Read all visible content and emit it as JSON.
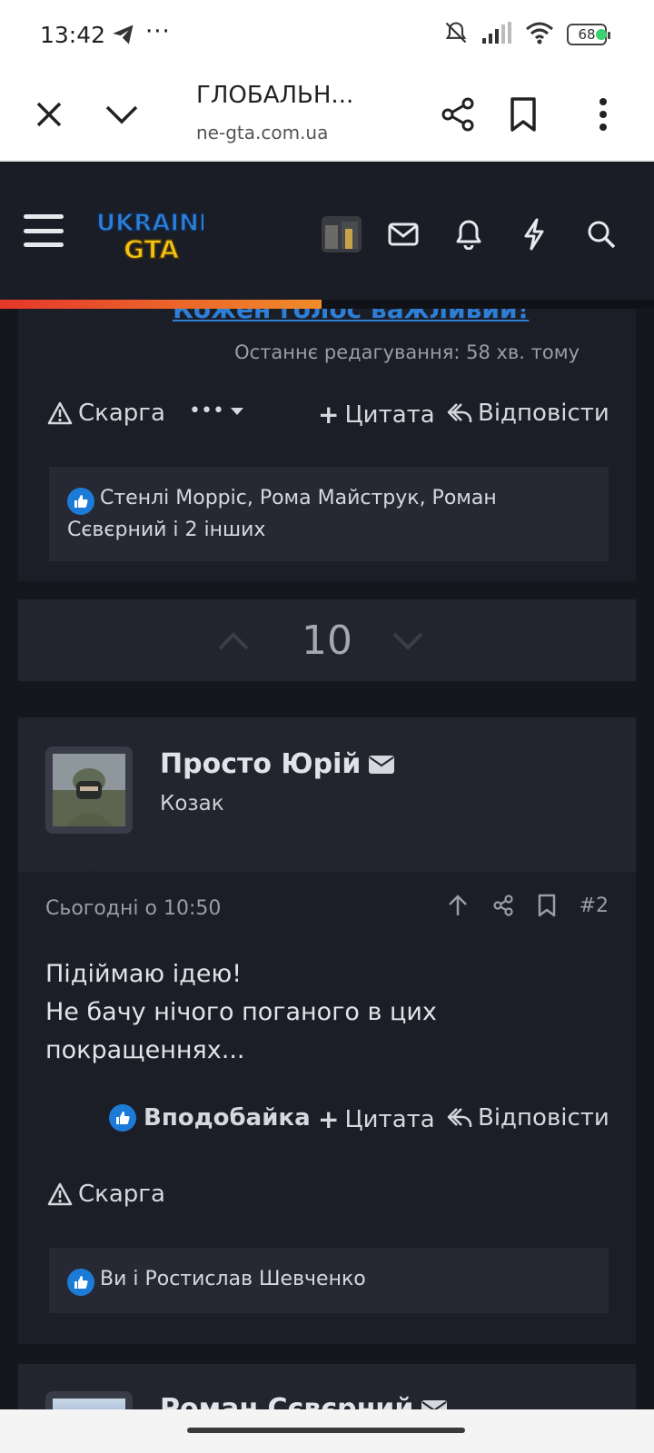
{
  "status_bar": {
    "time": "13:42",
    "dots": "···",
    "battery": "68",
    "icons": [
      "telegram-icon",
      "mute-icon",
      "signal-icon",
      "wifi-icon",
      "battery-icon"
    ]
  },
  "browser": {
    "title": "ГЛОБАЛЬН...",
    "url": "ne-gta.com.ua"
  },
  "site": {
    "logo_line1": "UKRAINE",
    "logo_line2": "GTA"
  },
  "post1": {
    "cut_link": "Кожен голос важливий!",
    "edited": "Останнє редагування: 58 хв. тому",
    "report": "Скарга",
    "more": "•••",
    "quote": "Цитата",
    "reply": "Відповісти",
    "likes_line1": "Стенлі Морріс, Рома Майструк, Роман",
    "likes_line2": "Сєвєрний і 2 інших"
  },
  "vote": {
    "count": "10"
  },
  "post2": {
    "username": "Просто Юрій",
    "user_title": "Козак",
    "date": "Сьогодні о 10:50",
    "number": "#2",
    "text": [
      "Підіймаю ідею!",
      "Не бачу нічого поганого в цих",
      "покращеннях..."
    ],
    "like": "Вподобайка",
    "quote": "Цитата",
    "reply": "Відповісти",
    "report": "Скарга",
    "likes": "Ви і Ростислав Шевченко"
  },
  "post3": {
    "username": "Роман Сєвєрний"
  },
  "colors": {
    "accent": "#1d7bd8",
    "link": "#2d7fd6",
    "bg": "#16171d",
    "progress_start": "#e5362b",
    "progress_end": "#f08c2a"
  }
}
